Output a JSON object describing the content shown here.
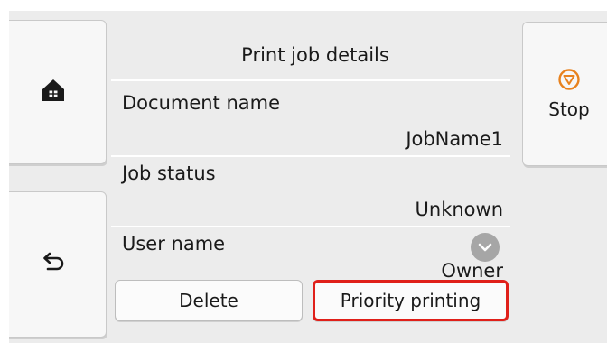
{
  "header": {
    "title": "Print job details"
  },
  "side_buttons": {
    "home_icon": "home-icon",
    "back_icon": "back-arrow-icon",
    "stop_icon": "stop-icon",
    "stop_label": "Stop"
  },
  "details": [
    {
      "label": "Document name",
      "value": "JobName1"
    },
    {
      "label": "Job status",
      "value": "Unknown"
    },
    {
      "label": "User name",
      "value": "Owner"
    }
  ],
  "actions": {
    "delete_label": "Delete",
    "priority_label": "Priority printing"
  },
  "colors": {
    "accent_border": "#e0201a",
    "stop_icon": "#e8821e",
    "background": "#ececec"
  }
}
